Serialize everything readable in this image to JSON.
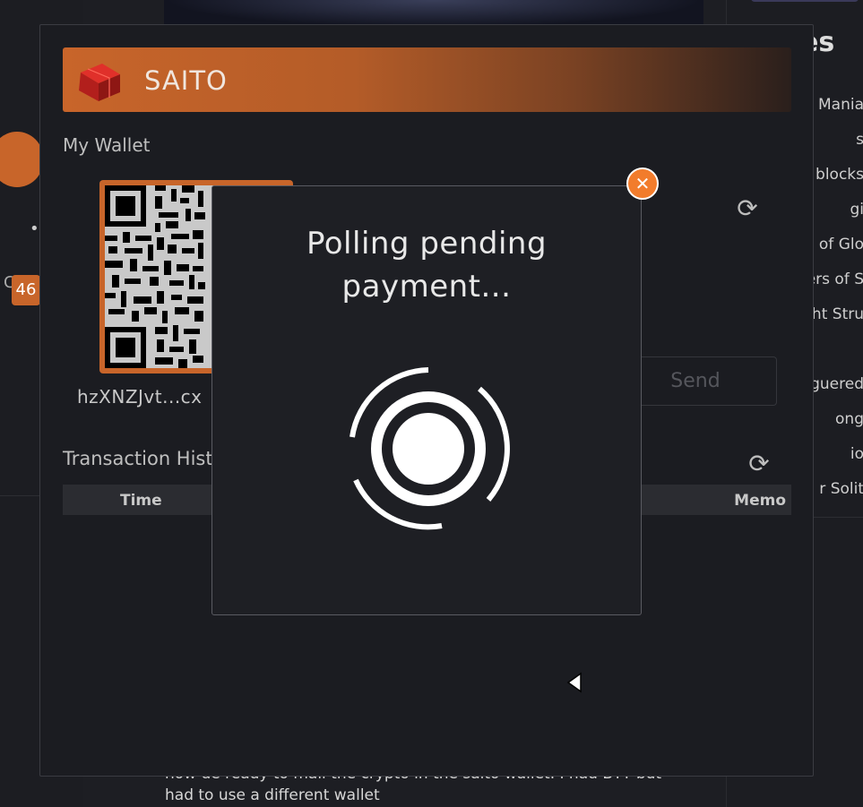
{
  "background": {
    "left_badge": "46",
    "left_letter": "C",
    "left_dots": "••",
    "footer_text_line1": "now de ready to mail the crypto in the saito wallet. I had BTT but",
    "footer_text_line2": "had to use a different wallet",
    "right_title": "es",
    "right_items": [
      "Mania",
      "s",
      "blocks",
      "gi",
      "of Glo",
      "ers of S",
      "ght Stru",
      "",
      "guered",
      "ong",
      "io",
      "r Solit"
    ]
  },
  "wallet": {
    "brand_name": "SAITO",
    "section_title": "My Wallet",
    "address_short": "hzXNZJvt...cx",
    "send_label": "Send",
    "tx_title": "Transaction Histo",
    "tx_columns": {
      "time": "Time",
      "memo": "Memo"
    }
  },
  "modal": {
    "message": "Polling pending payment...",
    "close_symbol": "✕"
  },
  "icons": {
    "refresh": "refresh-icon",
    "close": "close-icon",
    "spinner": "loading-spinner-icon",
    "logo": "saito-cube-logo"
  },
  "colors": {
    "accent": "#c8652a",
    "close_button": "#f27c2c",
    "panel_bg": "#1b1c21",
    "modal_bg": "#1e1f24"
  }
}
